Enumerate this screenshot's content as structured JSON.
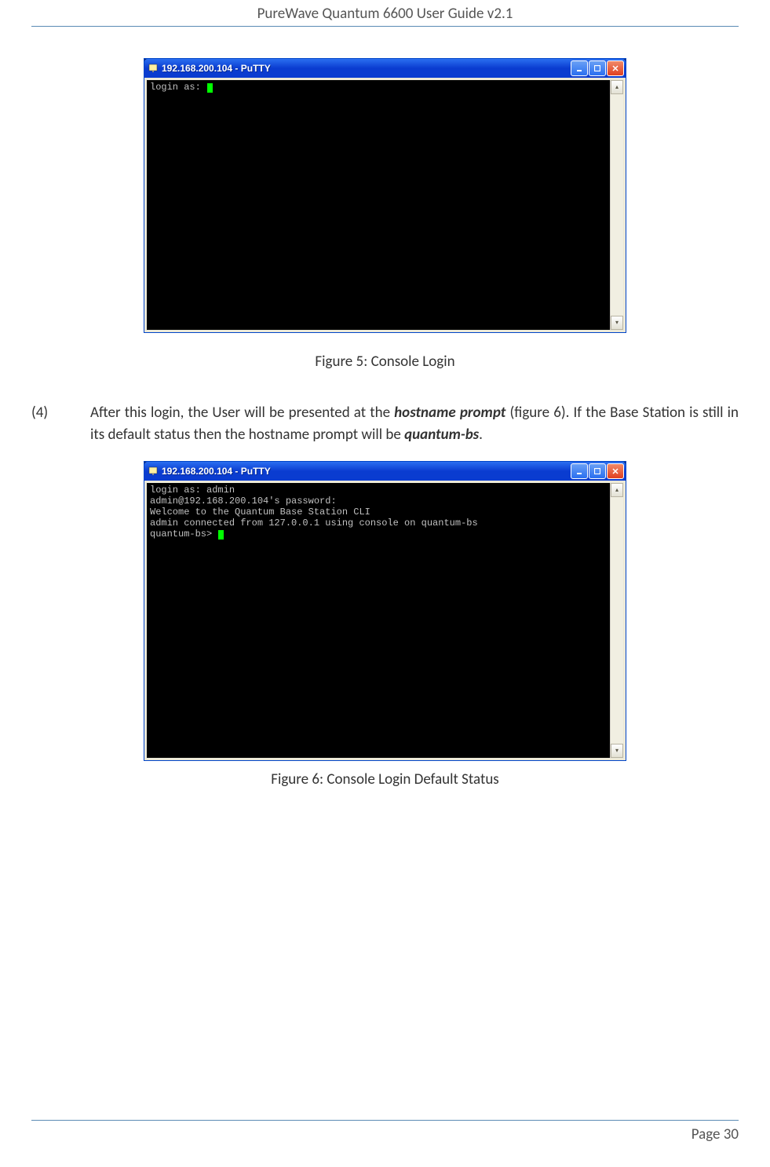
{
  "document": {
    "header_title": "PureWave Quantum 6600 User Guide v2.1",
    "page_label": "Page 30"
  },
  "figure5": {
    "window_title": "192.168.200.104 - PuTTY",
    "terminal_lines": [
      "login as: "
    ],
    "caption": "Figure 5: Console Login"
  },
  "step4": {
    "number": "(4)",
    "text_before": "After this login, the User will be presented at the ",
    "emph1": "hostname prompt",
    "text_mid": " (figure 6). If the Base Station is still in its default status then the hostname prompt will be ",
    "emph2": "quantum-bs",
    "text_after": "."
  },
  "figure6": {
    "window_title": "192.168.200.104 - PuTTY",
    "terminal_lines": [
      "login as: admin",
      "admin@192.168.200.104's password:",
      "Welcome to the Quantum Base Station CLI",
      "admin connected from 127.0.0.1 using console on quantum-bs",
      "quantum-bs> "
    ],
    "caption": "Figure 6: Console Login Default Status"
  }
}
